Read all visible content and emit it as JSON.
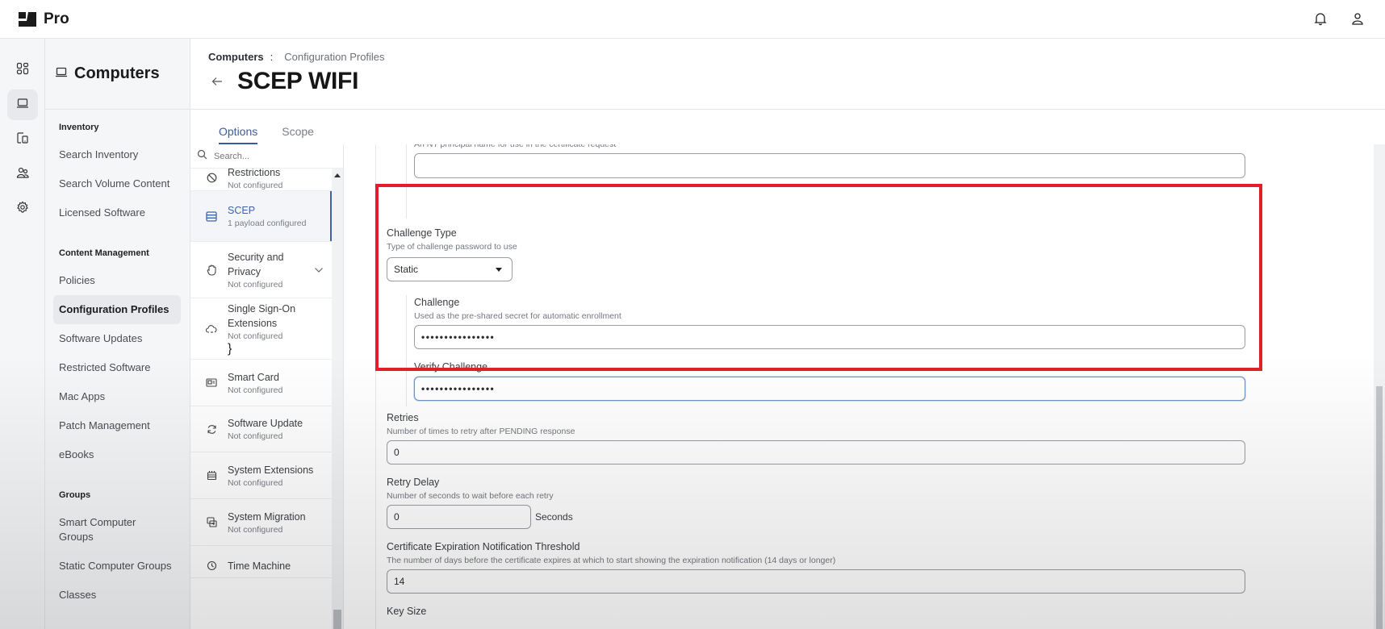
{
  "topbar": {
    "brand": "Pro",
    "icons": [
      "notifications-bell-icon",
      "user-account-icon"
    ]
  },
  "rail": {
    "items": [
      {
        "name": "dashboard",
        "icon": "dashboard-icon",
        "active": false
      },
      {
        "name": "computers",
        "icon": "laptop-icon",
        "active": true
      },
      {
        "name": "devices",
        "icon": "mobile-devices-icon",
        "active": false
      },
      {
        "name": "users",
        "icon": "users-icon",
        "active": false
      },
      {
        "name": "settings",
        "icon": "gear-icon",
        "active": false
      }
    ]
  },
  "leftnav": {
    "title": "Computers",
    "sections": [
      {
        "label": "Inventory",
        "items": [
          "Search Inventory",
          "Search Volume Content",
          "Licensed Software"
        ]
      },
      {
        "label": "Content Management",
        "items": [
          "Policies",
          "Configuration Profiles",
          "Software Updates",
          "Restricted Software",
          "Mac Apps",
          "Patch Management",
          "eBooks"
        ]
      },
      {
        "label": "Groups",
        "items": [
          "Smart Computer Groups",
          "Static Computer Groups",
          "Classes"
        ]
      }
    ],
    "active_item": "Configuration Profiles"
  },
  "header": {
    "breadcrumb_root": "Computers",
    "breadcrumb_sep": ":",
    "breadcrumb_current": "Configuration Profiles",
    "title": "SCEP WIFI"
  },
  "tabs": [
    {
      "label": "Options",
      "active": true
    },
    {
      "label": "Scope",
      "active": false
    }
  ],
  "payload_search": {
    "placeholder": "Search..."
  },
  "payloads": [
    {
      "name": "Restrictions",
      "status": "Not configured",
      "icon": "restrictions-icon",
      "active": false
    },
    {
      "name": "SCEP",
      "status": "1 payload configured",
      "icon": "scep-certificate-icon",
      "active": true
    },
    {
      "name": "Security and Privacy",
      "status": "Not configured",
      "icon": "hand-privacy-icon",
      "active": false,
      "expandable": true
    },
    {
      "name": "Single Sign-On Extensions",
      "status": "Not configured",
      "icon": "cloud-sso-icon",
      "active": false
    },
    {
      "name": "Smart Card",
      "status": "Not configured",
      "icon": "smart-card-icon",
      "active": false
    },
    {
      "name": "Software Update",
      "status": "Not configured",
      "icon": "refresh-icon",
      "active": false
    },
    {
      "name": "System Extensions",
      "status": "Not configured",
      "icon": "system-extensions-icon",
      "active": false
    },
    {
      "name": "System Migration",
      "status": "Not configured",
      "icon": "migration-icon",
      "active": false
    },
    {
      "name": "Time Machine",
      "status": "",
      "icon": "time-machine-icon",
      "active": false
    }
  ],
  "form": {
    "nt_principal": {
      "help": "An NT principal name for use in the certificate request",
      "value": ""
    },
    "challenge_type": {
      "label": "Challenge Type",
      "help": "Type of challenge password to use",
      "value": "Static"
    },
    "challenge": {
      "label": "Challenge",
      "help": "Used as the pre-shared secret for automatic enrollment",
      "value": "••••••••••••••••"
    },
    "verify_challenge": {
      "label": "Verify Challenge",
      "value": "••••••••••••••••"
    },
    "retries": {
      "label": "Retries",
      "help": "Number of times to retry after PENDING response",
      "value": "0"
    },
    "retry_delay": {
      "label": "Retry Delay",
      "help": "Number of seconds to wait before each retry",
      "value": "0",
      "unit": "Seconds"
    },
    "cert_expiration": {
      "label": "Certificate Expiration Notification Threshold",
      "help": "The number of days before the certificate expires at which to start showing the expiration notification (14 days or longer)",
      "value": "14"
    },
    "key_size": {
      "label": "Key Size"
    }
  },
  "colors": {
    "accent": "#2f5aa8",
    "highlight_annotation": "#e31e2a"
  }
}
